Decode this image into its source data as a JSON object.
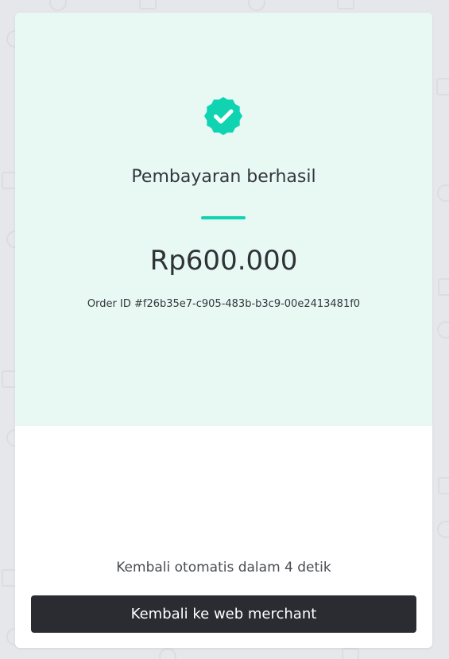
{
  "status": {
    "icon": "check-badge-icon",
    "title": "Pembayaran berhasil",
    "amount": "Rp600.000",
    "order_id": "Order ID #f26b35e7-c905-483b-b3c9-00e2413481f0"
  },
  "footer": {
    "countdown": "Kembali otomatis dalam 4 detik",
    "return_button": "Kembali ke web merchant"
  },
  "colors": {
    "accent": "#10d3b1",
    "success_bg": "#e8f9f4",
    "button_bg": "#2b2c31",
    "page_bg": "#e6e7ea"
  }
}
